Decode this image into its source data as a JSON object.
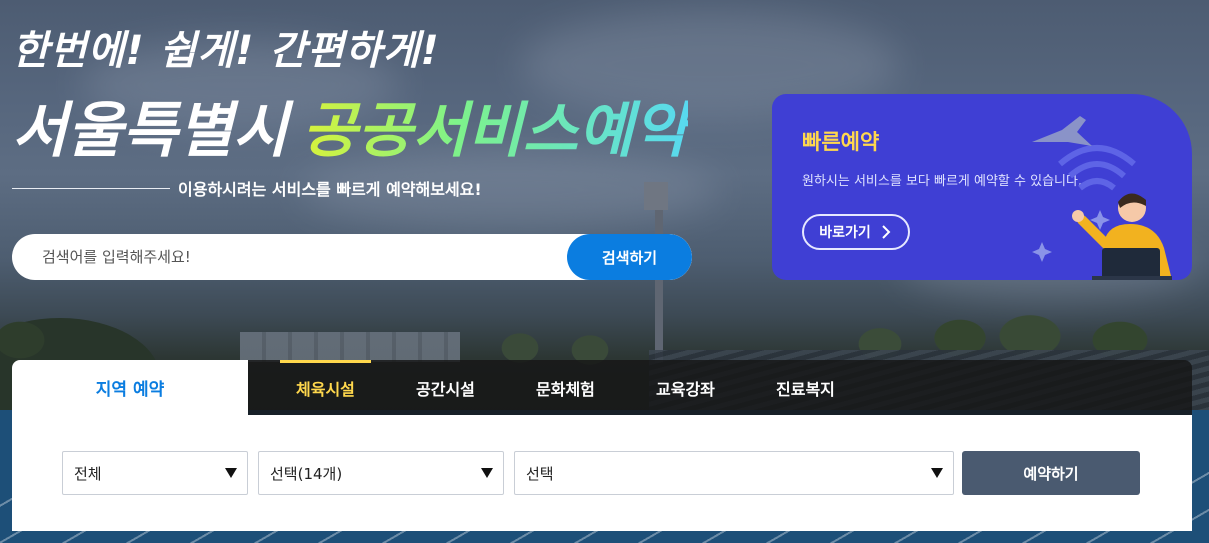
{
  "hero": {
    "tagline": "한번에! 쉽게! 간편하게!",
    "headline_part1": "서울특별시",
    "headline_part2": "공공서비스예약",
    "subtitle": "이용하시려는 서비스를 빠르게 예약해보세요!"
  },
  "search": {
    "placeholder": "검색어를 입력해주세요!",
    "button_label": "검색하기"
  },
  "quick_reserve": {
    "title": "빠른예약",
    "description": "원하시는 서비스를 보다 빠르게 예약할 수 있습니다.",
    "button_label": "바로가기",
    "button_icon": "chevron-right-icon",
    "title_color": "#ffd84d",
    "card_color": "#3f3fd4"
  },
  "tabs": {
    "region_tab": "지역 예약",
    "categories": [
      "체육시설",
      "공간시설",
      "문화체험",
      "교육강좌",
      "진료복지"
    ],
    "active_category": "체육시설"
  },
  "form": {
    "select_region": "전체",
    "select_facility": "선택(14개)",
    "select_detail": "선택",
    "submit_label": "예약하기"
  },
  "colors": {
    "accent_blue": "#0b7de0",
    "accent_yellow": "#ffd84d",
    "button_dark": "#4a5a70"
  }
}
